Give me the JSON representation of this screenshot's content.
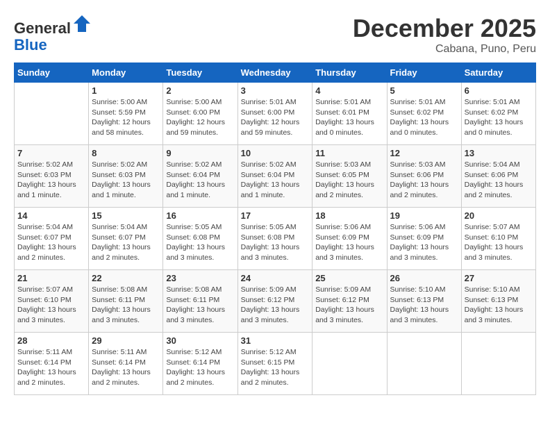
{
  "header": {
    "logo_line1": "General",
    "logo_line2": "Blue",
    "month_year": "December 2025",
    "location": "Cabana, Puno, Peru"
  },
  "days_of_week": [
    "Sunday",
    "Monday",
    "Tuesday",
    "Wednesday",
    "Thursday",
    "Friday",
    "Saturday"
  ],
  "weeks": [
    [
      {
        "day": "",
        "info": ""
      },
      {
        "day": "1",
        "info": "Sunrise: 5:00 AM\nSunset: 5:59 PM\nDaylight: 12 hours and 58 minutes."
      },
      {
        "day": "2",
        "info": "Sunrise: 5:00 AM\nSunset: 6:00 PM\nDaylight: 12 hours and 59 minutes."
      },
      {
        "day": "3",
        "info": "Sunrise: 5:01 AM\nSunset: 6:00 PM\nDaylight: 12 hours and 59 minutes."
      },
      {
        "day": "4",
        "info": "Sunrise: 5:01 AM\nSunset: 6:01 PM\nDaylight: 13 hours and 0 minutes."
      },
      {
        "day": "5",
        "info": "Sunrise: 5:01 AM\nSunset: 6:02 PM\nDaylight: 13 hours and 0 minutes."
      },
      {
        "day": "6",
        "info": "Sunrise: 5:01 AM\nSunset: 6:02 PM\nDaylight: 13 hours and 0 minutes."
      }
    ],
    [
      {
        "day": "7",
        "info": "Sunrise: 5:02 AM\nSunset: 6:03 PM\nDaylight: 13 hours and 1 minute."
      },
      {
        "day": "8",
        "info": "Sunrise: 5:02 AM\nSunset: 6:03 PM\nDaylight: 13 hours and 1 minute."
      },
      {
        "day": "9",
        "info": "Sunrise: 5:02 AM\nSunset: 6:04 PM\nDaylight: 13 hours and 1 minute."
      },
      {
        "day": "10",
        "info": "Sunrise: 5:02 AM\nSunset: 6:04 PM\nDaylight: 13 hours and 1 minute."
      },
      {
        "day": "11",
        "info": "Sunrise: 5:03 AM\nSunset: 6:05 PM\nDaylight: 13 hours and 2 minutes."
      },
      {
        "day": "12",
        "info": "Sunrise: 5:03 AM\nSunset: 6:06 PM\nDaylight: 13 hours and 2 minutes."
      },
      {
        "day": "13",
        "info": "Sunrise: 5:04 AM\nSunset: 6:06 PM\nDaylight: 13 hours and 2 minutes."
      }
    ],
    [
      {
        "day": "14",
        "info": "Sunrise: 5:04 AM\nSunset: 6:07 PM\nDaylight: 13 hours and 2 minutes."
      },
      {
        "day": "15",
        "info": "Sunrise: 5:04 AM\nSunset: 6:07 PM\nDaylight: 13 hours and 2 minutes."
      },
      {
        "day": "16",
        "info": "Sunrise: 5:05 AM\nSunset: 6:08 PM\nDaylight: 13 hours and 3 minutes."
      },
      {
        "day": "17",
        "info": "Sunrise: 5:05 AM\nSunset: 6:08 PM\nDaylight: 13 hours and 3 minutes."
      },
      {
        "day": "18",
        "info": "Sunrise: 5:06 AM\nSunset: 6:09 PM\nDaylight: 13 hours and 3 minutes."
      },
      {
        "day": "19",
        "info": "Sunrise: 5:06 AM\nSunset: 6:09 PM\nDaylight: 13 hours and 3 minutes."
      },
      {
        "day": "20",
        "info": "Sunrise: 5:07 AM\nSunset: 6:10 PM\nDaylight: 13 hours and 3 minutes."
      }
    ],
    [
      {
        "day": "21",
        "info": "Sunrise: 5:07 AM\nSunset: 6:10 PM\nDaylight: 13 hours and 3 minutes."
      },
      {
        "day": "22",
        "info": "Sunrise: 5:08 AM\nSunset: 6:11 PM\nDaylight: 13 hours and 3 minutes."
      },
      {
        "day": "23",
        "info": "Sunrise: 5:08 AM\nSunset: 6:11 PM\nDaylight: 13 hours and 3 minutes."
      },
      {
        "day": "24",
        "info": "Sunrise: 5:09 AM\nSunset: 6:12 PM\nDaylight: 13 hours and 3 minutes."
      },
      {
        "day": "25",
        "info": "Sunrise: 5:09 AM\nSunset: 6:12 PM\nDaylight: 13 hours and 3 minutes."
      },
      {
        "day": "26",
        "info": "Sunrise: 5:10 AM\nSunset: 6:13 PM\nDaylight: 13 hours and 3 minutes."
      },
      {
        "day": "27",
        "info": "Sunrise: 5:10 AM\nSunset: 6:13 PM\nDaylight: 13 hours and 3 minutes."
      }
    ],
    [
      {
        "day": "28",
        "info": "Sunrise: 5:11 AM\nSunset: 6:14 PM\nDaylight: 13 hours and 2 minutes."
      },
      {
        "day": "29",
        "info": "Sunrise: 5:11 AM\nSunset: 6:14 PM\nDaylight: 13 hours and 2 minutes."
      },
      {
        "day": "30",
        "info": "Sunrise: 5:12 AM\nSunset: 6:14 PM\nDaylight: 13 hours and 2 minutes."
      },
      {
        "day": "31",
        "info": "Sunrise: 5:12 AM\nSunset: 6:15 PM\nDaylight: 13 hours and 2 minutes."
      },
      {
        "day": "",
        "info": ""
      },
      {
        "day": "",
        "info": ""
      },
      {
        "day": "",
        "info": ""
      }
    ]
  ]
}
